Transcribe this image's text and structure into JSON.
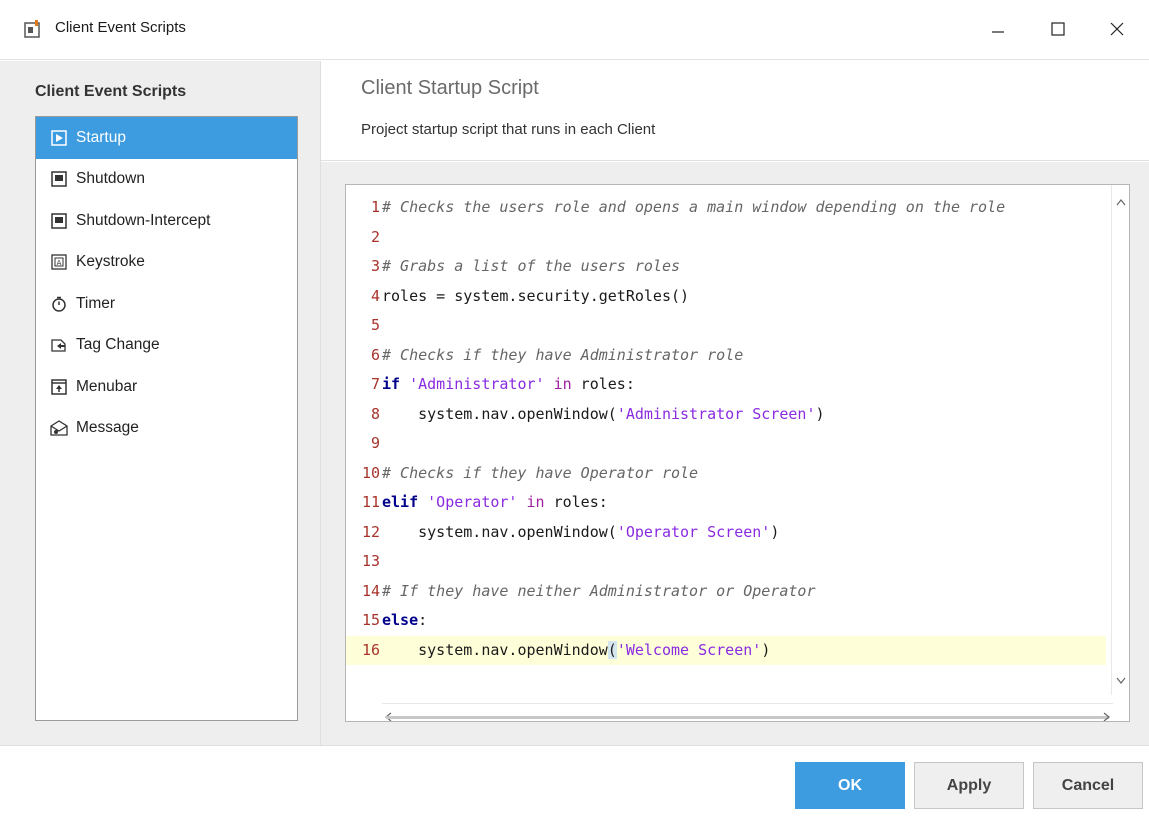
{
  "window": {
    "title": "Client Event Scripts",
    "icon": "script-app-icon",
    "controls": {
      "minimize": "minimize-icon",
      "maximize": "maximize-icon",
      "close": "close-icon"
    }
  },
  "sidebar": {
    "heading": "Client Event Scripts",
    "items": [
      {
        "label": "Startup",
        "icon": "startup-icon",
        "selected": true
      },
      {
        "label": "Shutdown",
        "icon": "shutdown-icon",
        "selected": false
      },
      {
        "label": "Shutdown-Intercept",
        "icon": "shutdown-intercept-icon",
        "selected": false
      },
      {
        "label": "Keystroke",
        "icon": "keystroke-icon",
        "selected": false
      },
      {
        "label": "Timer",
        "icon": "timer-icon",
        "selected": false
      },
      {
        "label": "Tag Change",
        "icon": "tag-change-icon",
        "selected": false
      },
      {
        "label": "Menubar",
        "icon": "menubar-icon",
        "selected": false
      },
      {
        "label": "Message",
        "icon": "message-icon",
        "selected": false
      }
    ]
  },
  "main": {
    "title": "Client Startup Script",
    "description": "Project startup script that runs in each Client"
  },
  "editor": {
    "lines": [
      {
        "num": "1",
        "tokens": [
          {
            "t": "# Checks the users role and opens a main window depending on the role",
            "c": "com"
          }
        ]
      },
      {
        "num": "2",
        "tokens": []
      },
      {
        "num": "3",
        "tokens": [
          {
            "t": "# Grabs a list of the users roles",
            "c": "com"
          }
        ]
      },
      {
        "num": "4",
        "tokens": [
          {
            "t": "roles = system.security.getRoles()",
            "c": "txt"
          }
        ]
      },
      {
        "num": "5",
        "tokens": []
      },
      {
        "num": "6",
        "tokens": [
          {
            "t": "# Checks if they have Administrator role",
            "c": "com"
          }
        ]
      },
      {
        "num": "7",
        "tokens": [
          {
            "t": "if",
            "c": "kw"
          },
          {
            "t": " ",
            "c": "txt"
          },
          {
            "t": "'Administrator'",
            "c": "str"
          },
          {
            "t": " ",
            "c": "txt"
          },
          {
            "t": "in",
            "c": "op"
          },
          {
            "t": " roles:",
            "c": "txt"
          }
        ]
      },
      {
        "num": "8",
        "tokens": [
          {
            "t": "    system.nav.openWindow(",
            "c": "txt"
          },
          {
            "t": "'Administrator Screen'",
            "c": "str"
          },
          {
            "t": ")",
            "c": "txt"
          }
        ]
      },
      {
        "num": "9",
        "tokens": []
      },
      {
        "num": "10",
        "tokens": [
          {
            "t": "# Checks if they have Operator role",
            "c": "com"
          }
        ]
      },
      {
        "num": "11",
        "tokens": [
          {
            "t": "elif",
            "c": "kw"
          },
          {
            "t": " ",
            "c": "txt"
          },
          {
            "t": "'Operator'",
            "c": "str"
          },
          {
            "t": " ",
            "c": "txt"
          },
          {
            "t": "in",
            "c": "op"
          },
          {
            "t": " roles:",
            "c": "txt"
          }
        ]
      },
      {
        "num": "12",
        "tokens": [
          {
            "t": "    system.nav.openWindow(",
            "c": "txt"
          },
          {
            "t": "'Operator Screen'",
            "c": "str"
          },
          {
            "t": ")",
            "c": "txt"
          }
        ]
      },
      {
        "num": "13",
        "tokens": []
      },
      {
        "num": "14",
        "tokens": [
          {
            "t": "# If they have neither Administrator or Operator",
            "c": "com"
          }
        ]
      },
      {
        "num": "15",
        "tokens": [
          {
            "t": "else",
            "c": "kw"
          },
          {
            "t": ":",
            "c": "txt"
          }
        ]
      },
      {
        "num": "16",
        "current": true,
        "tokens": [
          {
            "t": "    system.nav.openWindow",
            "c": "txt"
          },
          {
            "t": "(",
            "c": "hl"
          },
          {
            "t": "'Welcome Screen'",
            "c": "str"
          },
          {
            "t": ")",
            "c": "txt"
          }
        ]
      }
    ]
  },
  "footer": {
    "ok_label": "OK",
    "apply_label": "Apply",
    "cancel_label": "Cancel"
  },
  "colors": {
    "accent": "#3d9be0",
    "panel_bg": "#eeeeee",
    "current_line": "#fefed9",
    "line_number": "#a8332b",
    "keyword": "#00008b",
    "string": "#8a2be2",
    "comment": "#666666"
  }
}
